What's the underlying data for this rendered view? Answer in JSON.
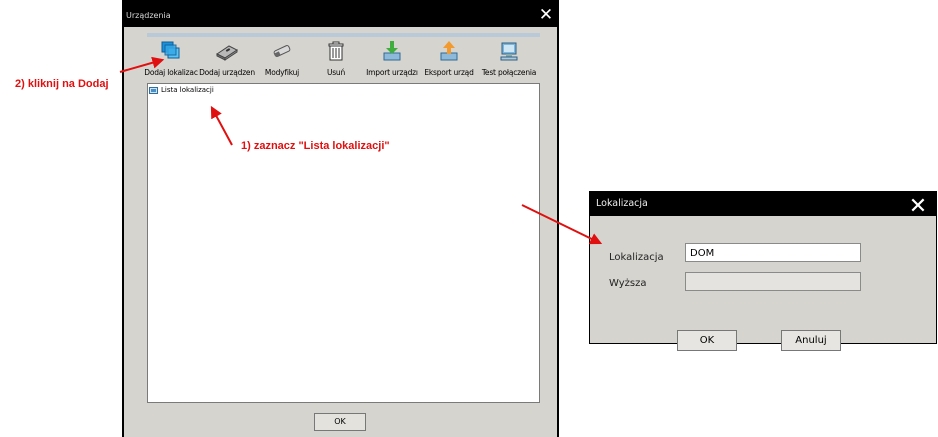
{
  "main_window": {
    "title": "Urządzenia",
    "close_symbol": "✕",
    "toolbar": [
      {
        "label": "Dodaj lokalizac",
        "icon": "add-location-icon"
      },
      {
        "label": "Dodaj urządzen",
        "icon": "add-device-icon"
      },
      {
        "label": "Modyfikuj",
        "icon": "modify-icon"
      },
      {
        "label": "Usuń",
        "icon": "trash-icon"
      },
      {
        "label": "Import urządzı",
        "icon": "import-icon"
      },
      {
        "label": "Eksport urząd",
        "icon": "export-icon"
      },
      {
        "label": "Test połączenia",
        "icon": "connection-test-icon"
      }
    ],
    "tree": {
      "root_label": "Lista lokalizacji",
      "icon": "location-list-icon"
    },
    "ok_label": "OK"
  },
  "dialog": {
    "title": "Lokalizacja",
    "close_symbol": "✕",
    "fields": {
      "location_label": "Lokalizacja",
      "location_value": "DOM",
      "parent_label": "Wyższa",
      "parent_value": ""
    },
    "ok_label": "OK",
    "cancel_label": "Anuluj"
  },
  "annotations": {
    "step2": "2) kliknij na Dodaj",
    "step1": "1) zaznacz \"Lista lokalizacji\""
  },
  "colors": {
    "annotation": "#e01010",
    "titlebar": "#000000",
    "window_bg": "#d6d4cf"
  }
}
